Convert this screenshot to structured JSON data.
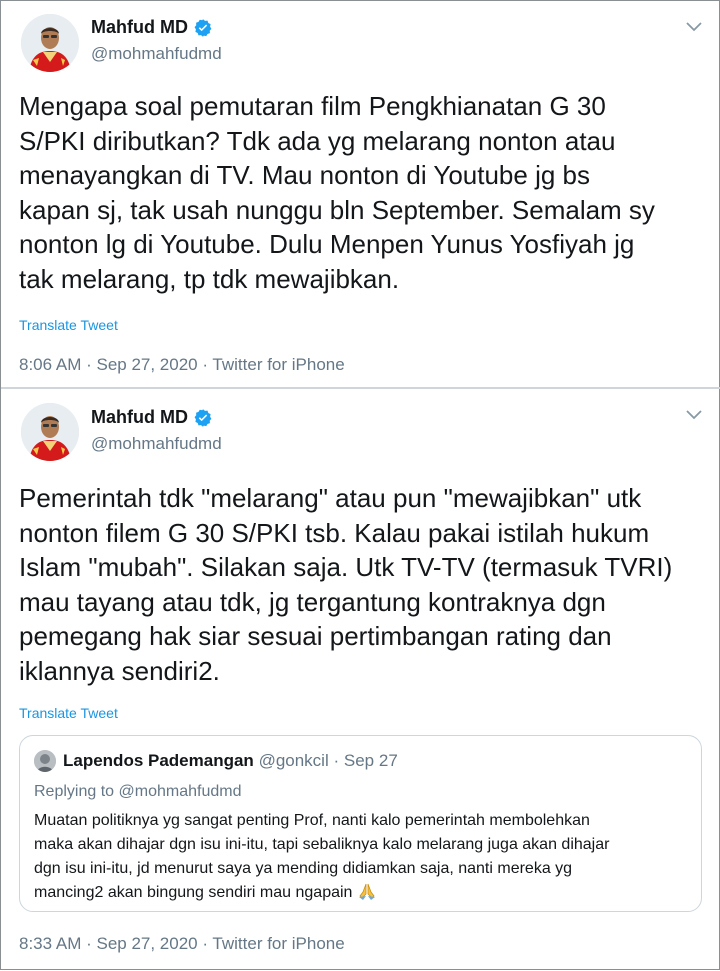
{
  "tweets": [
    {
      "author": {
        "name": "Mahfud MD",
        "handle": "@mohmahfudmd"
      },
      "text": "Mengapa soal pemutaran film Pengkhianatan G 30\nS/PKI diributkan? Tdk ada yg melarang nonton atau\nmenayangkan di TV. Mau nonton di Youtube jg bs\nkapan sj, tak usah nunggu bln September. Semalam sy\nnonton lg di Youtube. Dulu Menpen Yunus Yosfiyah jg\ntak melarang, tp tdk mewajibkan.",
      "translate_label": "Translate Tweet",
      "meta": "8:06 AM · Sep 27, 2020 · Twitter for iPhone"
    },
    {
      "author": {
        "name": "Mahfud MD",
        "handle": "@mohmahfudmd"
      },
      "text": "Pemerintah tdk \"melarang\" atau pun \"mewajibkan\" utk\nnonton filem G 30 S/PKI tsb. Kalau pakai istilah hukum\nIslam \"mubah\". Silakan saja. Utk TV-TV (termasuk TVRI)\nmau tayang atau tdk, jg tergantung kontraknya dgn\npemegang hak siar sesuai pertimbangan rating dan\niklannya sendiri2.",
      "translate_label": "Translate Tweet",
      "meta": "8:33 AM · Sep 27, 2020 · Twitter for iPhone",
      "quoted": {
        "name": "Lapendos Pademangan",
        "handle": "@gonkcil",
        "date": "Sep 27",
        "replying_prefix": "Replying to",
        "replying_to": "@mohmahfudmd",
        "text": "Muatan politiknya yg sangat penting Prof, nanti kalo pemerintah membolehkan\nmaka akan dihajar dgn isu ini-itu, tapi sebaliknya kalo melarang juga akan dihajar\ndgn isu ini-itu, jd menurut saya ya mending didiamkan saja, nanti mereka yg\nmancing2 akan bingung sendiri mau ngapain",
        "emoji_icon": "folded-hands-icon"
      }
    }
  ],
  "colors": {
    "link": "#1b95e0",
    "secondary": "#657786",
    "verified": "#1da1f2",
    "text": "#14171a"
  }
}
